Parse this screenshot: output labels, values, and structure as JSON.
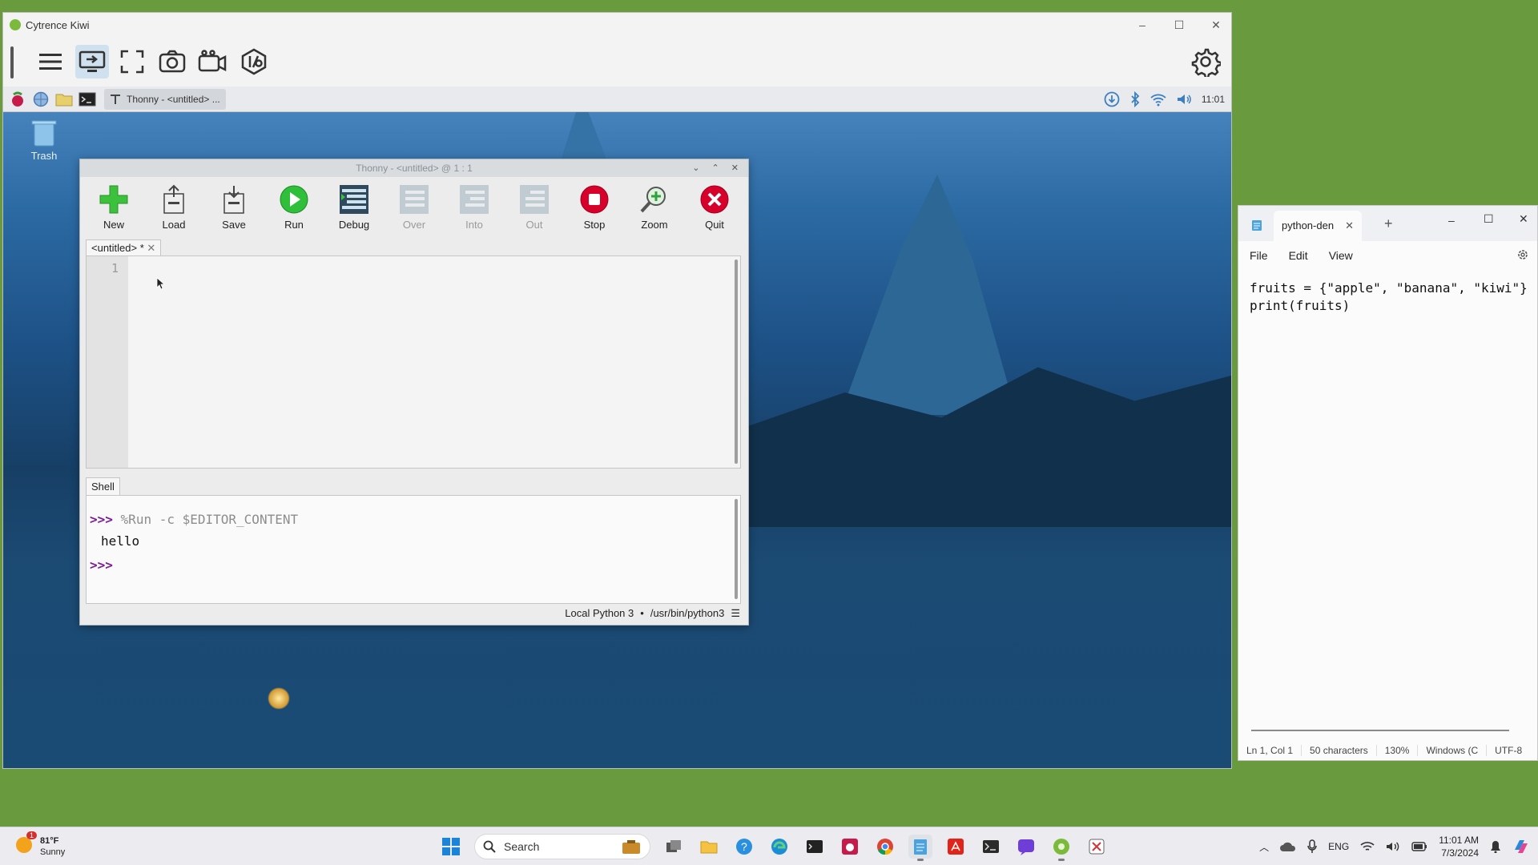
{
  "kiwi": {
    "title": "Cytrence Kiwi",
    "controls": [
      "–",
      "☐",
      "✕"
    ],
    "toolbar": [
      "menu-icon",
      "screen-share-icon",
      "fullscreen-icon",
      "screenshot-icon",
      "record-icon",
      "io-icon"
    ]
  },
  "rpi": {
    "taskbar_item": "Thonny - <untitled> ...",
    "clock": "11:01",
    "trash_label": "Trash"
  },
  "thonny": {
    "title": "Thonny - <untitled> @ 1 : 1",
    "toolbar": [
      {
        "label": "New",
        "icon": "new-file-icon",
        "enabled": true
      },
      {
        "label": "Load",
        "icon": "load-icon",
        "enabled": true
      },
      {
        "label": "Save",
        "icon": "save-icon",
        "enabled": true
      },
      {
        "label": "Run",
        "icon": "run-icon",
        "enabled": true
      },
      {
        "label": "Debug",
        "icon": "debug-icon",
        "enabled": true
      },
      {
        "label": "Over",
        "icon": "step-over-icon",
        "enabled": false
      },
      {
        "label": "Into",
        "icon": "step-into-icon",
        "enabled": false
      },
      {
        "label": "Out",
        "icon": "step-out-icon",
        "enabled": false
      },
      {
        "label": "Stop",
        "icon": "stop-icon",
        "enabled": true
      },
      {
        "label": "Zoom",
        "icon": "zoom-icon",
        "enabled": true
      },
      {
        "label": "Quit",
        "icon": "quit-icon",
        "enabled": true
      }
    ],
    "editor_tab": "<untitled> *",
    "line_number": "1",
    "shell_tab": "Shell",
    "shell": {
      "prompt": ">>>",
      "command": "%Run -c $EDITOR_CONTENT",
      "output": "hello"
    },
    "status": {
      "interpreter": "Local Python 3",
      "separator": "•",
      "path": "/usr/bin/python3"
    }
  },
  "notepad": {
    "tab_title": "python-den",
    "menu": [
      "File",
      "Edit",
      "View"
    ],
    "lines": [
      "fruits = {\"apple\", \"banana\", \"kiwi\"}",
      "print(fruits)"
    ],
    "status": {
      "position": "Ln 1, Col 1",
      "chars": "50 characters",
      "zoom": "130%",
      "line_ending": "Windows (C",
      "encoding": "UTF-8"
    }
  },
  "windows_taskbar": {
    "weather_temp": "81°F",
    "weather_desc": "Sunny",
    "weather_badge": "1",
    "search_placeholder": "Search",
    "language": "ENG",
    "time": "11:01 AM",
    "date": "7/3/2024"
  },
  "colors": {
    "desktop_bg": "#6a9a3e",
    "run_green": "#2fbf3a",
    "stop_red": "#d6002b",
    "prompt_purple": "#7a1f92"
  }
}
